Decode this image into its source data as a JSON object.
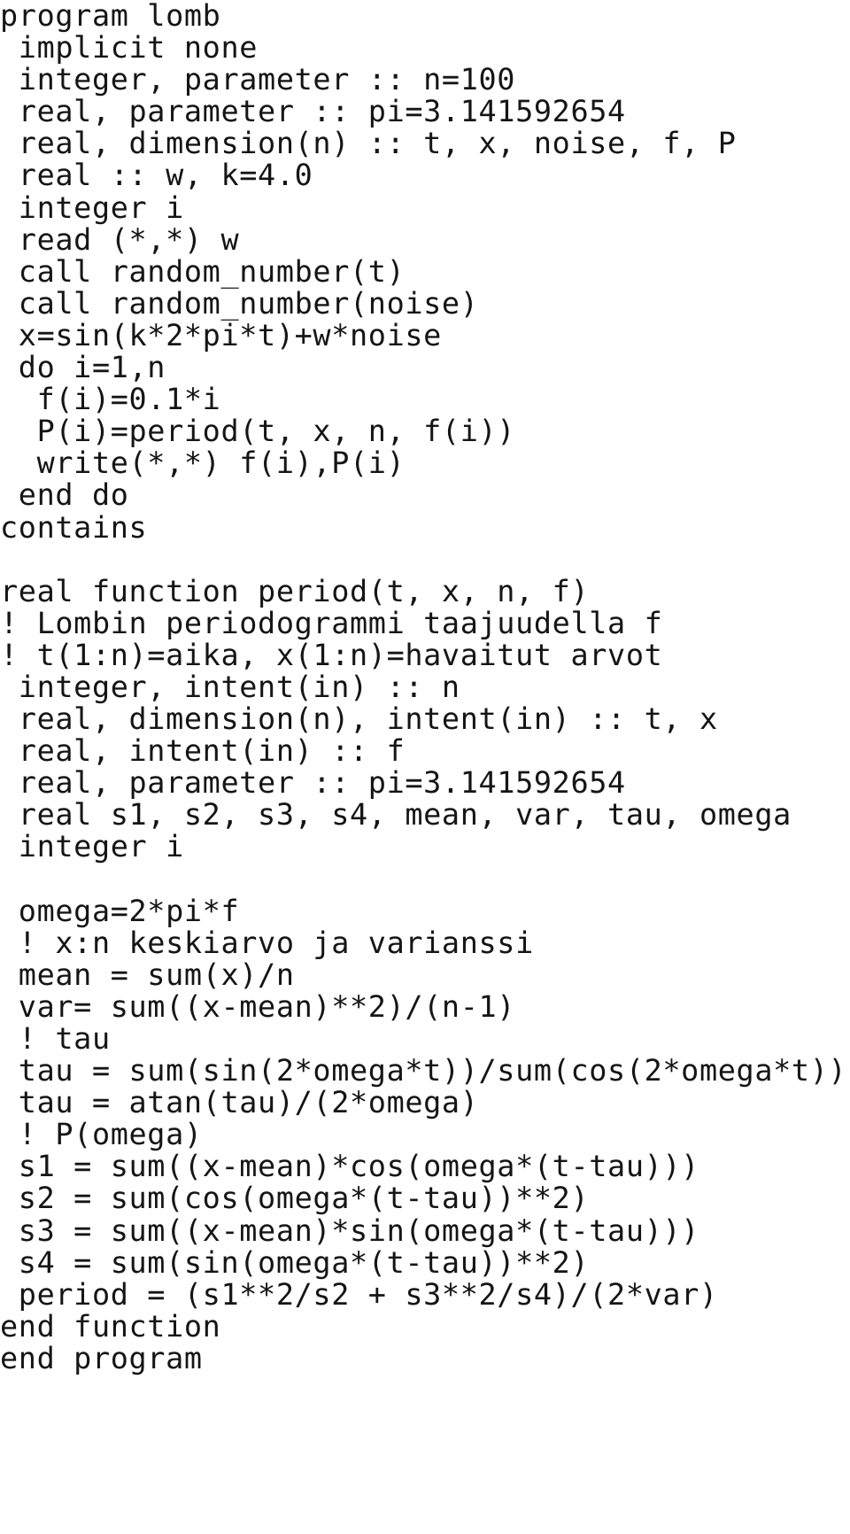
{
  "document": {
    "kind": "source-code-listing",
    "language": "Fortran",
    "program_name": "lomb",
    "background_color": "#ffffff",
    "text_color": "#151515",
    "lines": [
      "program lomb",
      " implicit none",
      " integer, parameter :: n=100",
      " real, parameter :: pi=3.141592654",
      " real, dimension(n) :: t, x, noise, f, P",
      " real :: w, k=4.0",
      " integer i",
      " read (*,*) w",
      " call random_number(t)",
      " call random_number(noise)",
      " x=sin(k*2*pi*t)+w*noise",
      " do i=1,n",
      "  f(i)=0.1*i",
      "  P(i)=period(t, x, n, f(i))",
      "  write(*,*) f(i),P(i)",
      " end do",
      "contains",
      "",
      "real function period(t, x, n, f)",
      "! Lombin periodogrammi taajuudella f",
      "! t(1:n)=aika, x(1:n)=havaitut arvot",
      " integer, intent(in) :: n",
      " real, dimension(n), intent(in) :: t, x",
      " real, intent(in) :: f",
      " real, parameter :: pi=3.141592654",
      " real s1, s2, s3, s4, mean, var, tau, omega",
      " integer i",
      "",
      " omega=2*pi*f",
      " ! x:n keskiarvo ja varianssi",
      " mean = sum(x)/n",
      " var= sum((x-mean)**2)/(n-1)",
      " ! tau",
      " tau = sum(sin(2*omega*t))/sum(cos(2*omega*t))",
      " tau = atan(tau)/(2*omega)",
      " ! P(omega)",
      " s1 = sum((x-mean)*cos(omega*(t-tau)))",
      " s2 = sum(cos(omega*(t-tau))**2)",
      " s3 = sum((x-mean)*sin(omega*(t-tau)))",
      " s4 = sum(sin(omega*(t-tau))**2)",
      " period = (s1**2/s2 + s3**2/s4)/(2*var)",
      "end function",
      "end program"
    ]
  }
}
